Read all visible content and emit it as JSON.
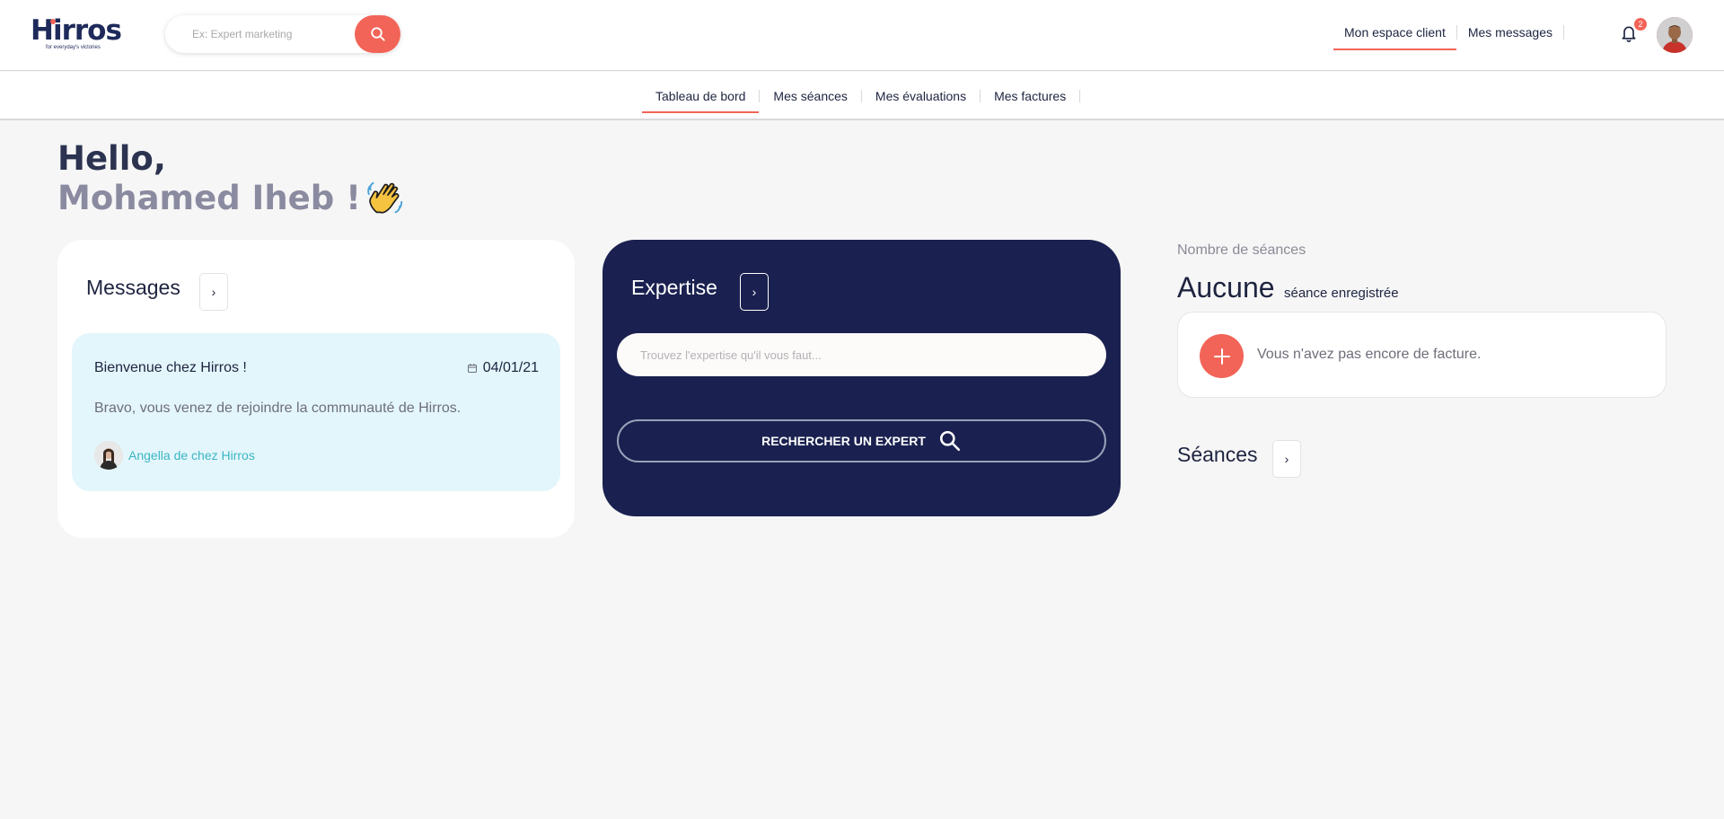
{
  "brand": {
    "name": "Hirros",
    "tagline": "for everyday's victories",
    "accent": "#f26457",
    "navy": "#1a2150"
  },
  "header": {
    "search_placeholder": "Ex: Expert marketing",
    "nav": [
      "Mon espace client",
      "Mes messages"
    ],
    "notifications_count": "2"
  },
  "subnav": {
    "tabs": [
      "Tableau de bord",
      "Mes séances",
      "Mes évaluations",
      "Mes factures"
    ]
  },
  "greeting": {
    "hello": "Hello,",
    "name": "Mohamed Iheb !"
  },
  "messages": {
    "title": "Messages",
    "arrow": "›",
    "item": {
      "subject": "Bienvenue chez Hirros !",
      "date": "04/01/21",
      "body": "Bravo, vous venez de rejoindre la communauté de Hirros.",
      "author": "Angella de chez Hirros"
    }
  },
  "expertise": {
    "title": "Expertise",
    "arrow": "›",
    "input_placeholder": "Trouvez l'expertise qu'il vous faut...",
    "search_button": "RECHERCHER UN EXPERT"
  },
  "stats": {
    "label": "Nombre de séances",
    "value": "Aucune",
    "suffix": "séance enregistrée",
    "invoice_text": "Vous n'avez pas encore de facture."
  },
  "seances": {
    "title": "Séances",
    "arrow": "›"
  }
}
